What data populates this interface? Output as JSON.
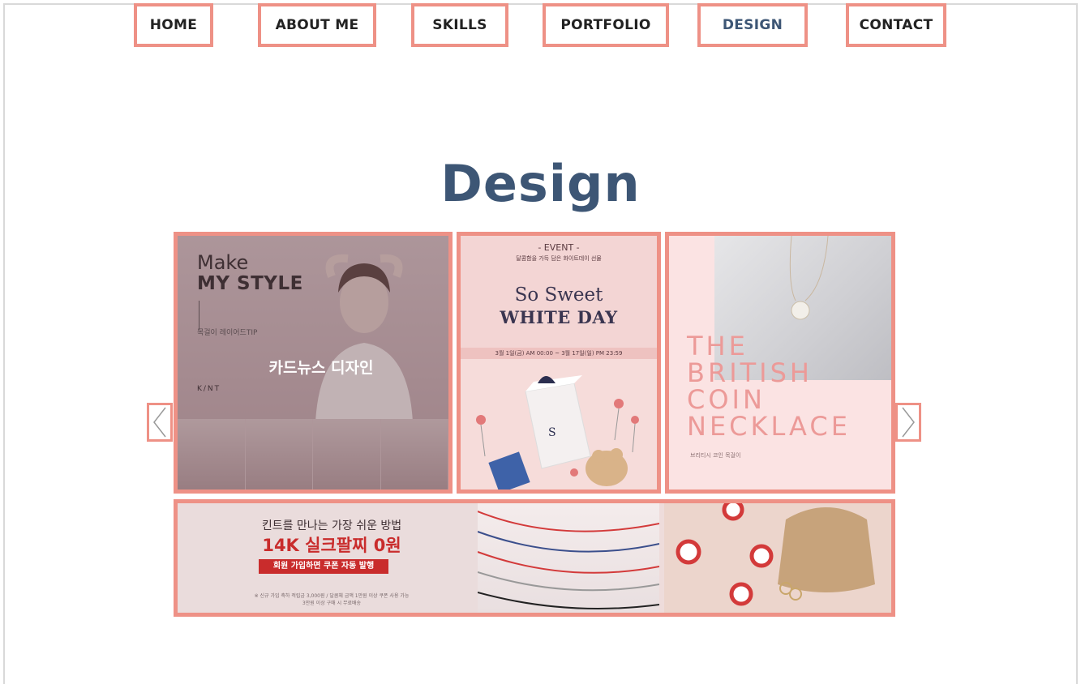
{
  "nav": {
    "items": [
      {
        "label": "HOME"
      },
      {
        "label": "ABOUT ME"
      },
      {
        "label": "SKILLS"
      },
      {
        "label": "PORTFOLIO"
      },
      {
        "label": "DESIGN",
        "active": true
      },
      {
        "label": "CONTACT"
      }
    ]
  },
  "section": {
    "title": "Design"
  },
  "gallery": {
    "card1": {
      "make": "Make",
      "style": "MY STYLE",
      "tip": "목걸이 레이어드TIP",
      "logo": "K/NT",
      "caption": "카드뉴스 디자인"
    },
    "card2": {
      "event": "- EVENT -",
      "event_sub": "달콤함을 가득 담은 화이트데이 선물",
      "sweet": "So Sweet",
      "white": "WHITE DAY",
      "date": "3월 1일(금) AM 00:00 ~ 3월 17일(일) PM 23:59"
    },
    "card3": {
      "words": [
        "THE",
        "BRITISH",
        "COIN",
        "NECKLACE"
      ],
      "sub": "브리티시 코인 목걸이"
    },
    "card4": {
      "headline": "킨트를 만나는 가장 쉬운 방법",
      "offer": "14K 실크팔찌 0원",
      "button": "회원 가입하면 쿠폰 자동 발행",
      "fine1": "※ 신규 가입 축하 적립금 3,000원 / 달콤체 금액 1만원 이상 쿠폰 사용 가능",
      "fine2": "3만원 이상 구매 시 무료배송"
    }
  },
  "colors": {
    "accent": "#ee9186",
    "title": "#3d5675",
    "offer_red": "#c92c2c"
  },
  "icons": {
    "prev": "chevron-left-icon",
    "next": "chevron-right-icon"
  }
}
